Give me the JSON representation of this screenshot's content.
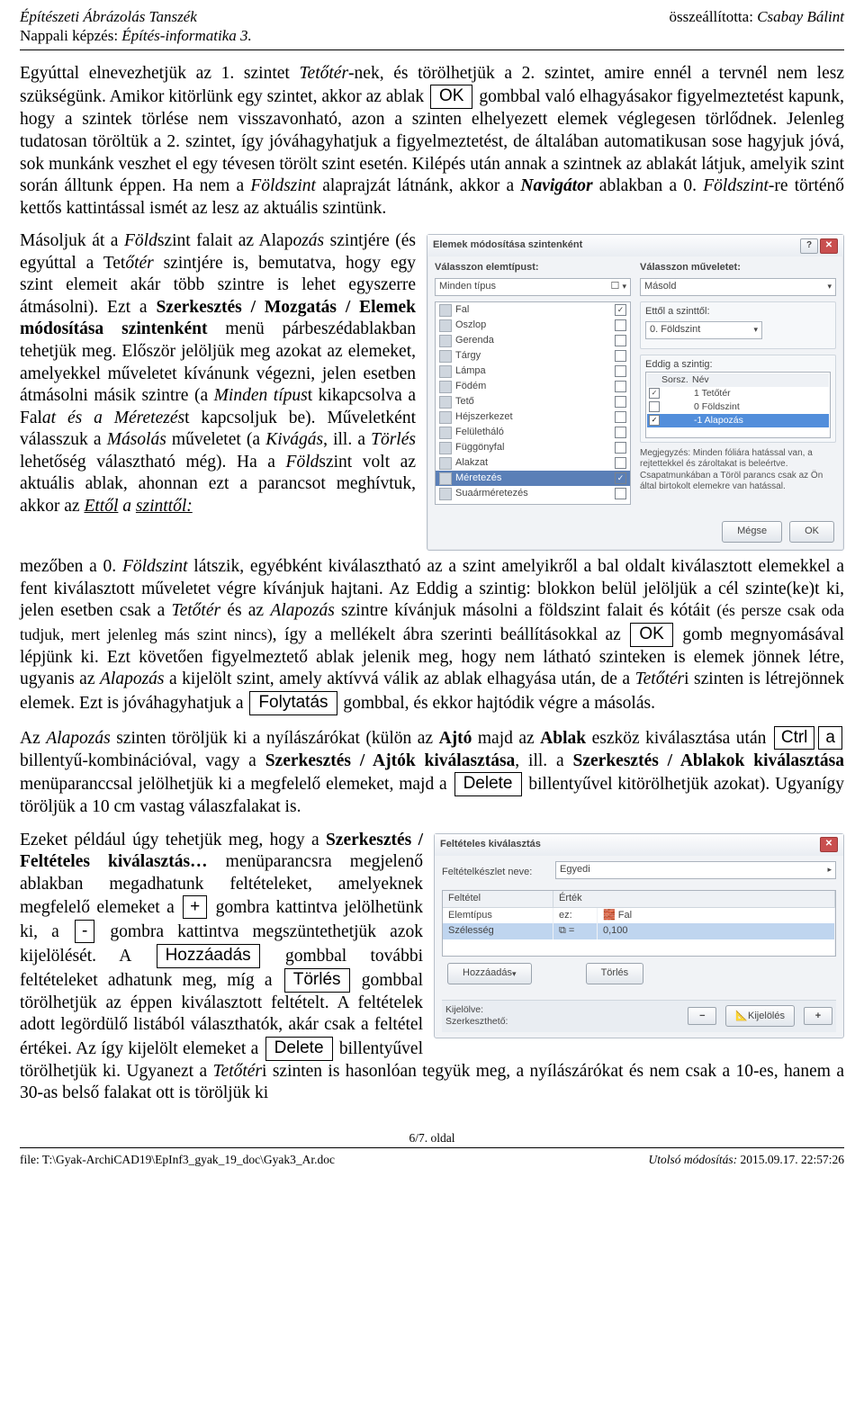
{
  "header": {
    "left_line1_ital": "Építészeti Ábrázolás Tanszék",
    "left_line2_prefix": "Nappali képzés:   ",
    "left_line2_ital": "Építés-informatika 3.",
    "right_prefix": "összeállította: ",
    "right_ital": "Csabay Bálint"
  },
  "keys": {
    "ok": "OK",
    "folytatas": "Folytatás",
    "ctrl": "Ctrl",
    "a": "a",
    "delete": "Delete",
    "plus": "+",
    "minus": "-",
    "hozzaadas": "Hozzáadás",
    "torles": "Törlés"
  },
  "p1": {
    "a": "Egyúttal elnevezhetjük az 1. szintet ",
    "b": "Tetőtér",
    "c": "-nek, és törölhetjük a 2. szintet, amire ennél a tervnél nem lesz szükségünk. Amikor kitörlünk egy szintet, akkor az ablak ",
    "d": " gombbal való elhagyásakor figyelmeztetést kapunk, hogy a szintek törlése nem visszavonható, azon a szinten elhelyezett elemek véglegesen törlődnek. Jelenleg tudatosan töröltük a 2. szintet, így jóváhagyhatjuk a figyelmeztetést, de általában automatikusan sose hagyjuk jóvá, sok munkánk veszhet el egy tévesen törölt szint esetén. Kilépés után annak a szintnek az ablakát látjuk, amelyik szint során álltunk éppen. Ha nem a ",
    "e": "Földszint",
    "f": " alaprajzát látnánk, akkor a ",
    "g": "Navigátor",
    "h": " ablakban a 0. ",
    "i": "Földszint",
    "j": "-re történő kettős kattintással ismét az lesz az aktuális szintünk."
  },
  "p2": {
    "a": "Másoljuk át a ",
    "b": "Föld",
    "c": "szint falait az Alap",
    "d": "ozás",
    "e": " szintjére (és egyúttal a Tet",
    "f": "őtér",
    "g": " szintjére is, bemutatva, hogy egy szint elemeit akár több szintre is lehet egyszerre átmásolni). Ezt a ",
    "h": "Szerkesztés / Mozgatás / Elemek módosítása szintenként",
    "i": " menü párbeszédablakban tehetjük meg. Először jelöljük meg azokat az elemeket, amelyekkel műveletet kívánunk végezni, jelen esetben átmásolni másik szintre (a ",
    "j": "Minden típus",
    "k": "t kikapcsolva a Fal",
    "l": "at és a ",
    "m": "Méretezés",
    "n": "t kapcsoljuk be). Műveletként válasszuk a ",
    "o": "Másolás",
    "p": " műveletet (a ",
    "q": "Kivágás",
    "r": ", ill. a ",
    "s": "Törlés",
    "t": " lehetőség választható még). Ha a ",
    "u": "Föld",
    "v": "szint volt az aktuális ablak, ahonnan ezt a parancsot meghívtuk, akkor az ",
    "w": "Ettől",
    "x": " a ",
    "y": "szinttől:"
  },
  "p3": {
    "a": "mezőben a 0. ",
    "b": "Földszint",
    "c": " látszik, egyébként kiválasztható az a szint amelyikről a bal oldalt kiválasztott elemekkel a fent kiválasztott műveletet végre kívánjuk hajtani. Az Eddig a szintig: blokkon belül jelöljük a cél szinte(ke)t ki, jelen esetben csak a ",
    "d": "Tetőtér",
    "e": " és az ",
    "f": "Alapozás",
    "g": " szintre kívánjuk másolni a földszint falait és kótáit ",
    "h": "(és persze csak oda tudjuk, mert jelenleg más szint nincs)",
    "i": ", így a mellékelt ábra szerinti beállításokkal az ",
    "j": " gomb megnyomásával lépjünk ki. Ezt követően figyelmeztető ablak jelenik meg, hogy nem látható szinteken is elemek jönnek létre, ugyanis az ",
    "k": "Alapozás",
    "l": " a kijelölt szint, amely aktívvá válik az ablak elhagyása után, de a ",
    "m": "Tetőtér",
    "n": "i szinten is létrejönnek elemek. Ezt is jóváhagyhatjuk a ",
    "o": " gombbal, és ekkor hajtódik végre a másolás."
  },
  "p4": {
    "a": "Az ",
    "b": "Alapozás",
    "c": " szinten töröljük ki a nyílászárókat (külön az ",
    "d": "Ajtó",
    "e": " majd az ",
    "f": "Ablak",
    "g": " eszköz kiválasztása után ",
    "h": " billentyű-kombinációval, vagy a ",
    "i": "Szerkesztés / Ajtók kiválasztása",
    "j": ", ill. a ",
    "k": "Szerkesztés / Ablakok kiválasztása",
    "l": " menüparanccsal jelölhetjük ki a megfelelő elemeket, majd a ",
    "m": " billentyűvel kitörölhetjük azokat). Ugyanígy töröljük a 10 cm vastag válaszfalakat is."
  },
  "p5": {
    "a": "Ezeket például úgy tehetjük meg, hogy a ",
    "b": "Szerkesztés / Feltételes kiválasztás…",
    "c": " menüparancsra megjelenő ablakban megadhatunk feltételeket, amelyeknek megfelelő elemeket a ",
    "d": " gombra kattintva jelölhetünk ki, a ",
    "e": " gombra kattintva megszüntethetjük azok kijelölését. A ",
    "f": " gombbal további feltételeket adhatunk meg, míg a ",
    "g": " gombbal törölhetjük az éppen kiválasztott feltételt. A feltételek adott legördülő listából választhatók, akár csak a feltétel értékei. Az így kijelölt elemeket a ",
    "h": " billentyűvel törölhetjük ki. Ugyanezt a ",
    "i": "Tetőtér",
    "j": "i szinten is hasonlóan tegyük meg, a nyílászárókat és nem csak a 10-es, hanem a 30-as belső falakat ott is töröljük ki"
  },
  "dialog1": {
    "title": "Elemek módosítása szintenként",
    "left_label": "Válasszon elemtípust:",
    "right_label": "Válasszon műveletet:",
    "combo_left": "Minden típus",
    "combo_right": "Másold",
    "items": [
      "Fal",
      "Oszlop",
      "Gerenda",
      "Tárgy",
      "Lámpa",
      "Födém",
      "Tető",
      "Héjszerkezet",
      "Felületháló",
      "Függönyfal",
      "Alakzat",
      "Méretezés",
      "Suaárméretezés"
    ],
    "checked": [
      true,
      false,
      false,
      false,
      false,
      false,
      false,
      false,
      false,
      false,
      false,
      true,
      false
    ],
    "sel_index": 11,
    "from_label": "Ettől a szinttől:",
    "from_value": "0. Földszint",
    "to_label": "Eddig a szintig:",
    "lv_head_a": "Sorsz.",
    "lv_head_b": "Név",
    "levels": [
      {
        "chk": true,
        "a": "",
        "b": "1 Tetőtér"
      },
      {
        "chk": false,
        "a": "",
        "b": "0 Földszint"
      },
      {
        "chk": true,
        "a": "",
        "b": "-1 Alapozás",
        "sel": true
      }
    ],
    "note": "Megjegyzés: Minden fóliára hatással van, a rejtettekkel és zároltakat is beleértve. Csapatmunkában a Töröl parancs csak az Ön által birtokolt elemekre van hatással.",
    "btn_cancel": "Mégse",
    "btn_ok": "OK"
  },
  "dialog2": {
    "title": "Feltételes kiválasztás",
    "set_label": "Feltételkészlet neve:",
    "set_value": "Egyedi",
    "col_a": "Feltétel",
    "col_b": "Érték",
    "row1": {
      "a": "Elemtípus",
      "op": "ez:",
      "val": "Fal"
    },
    "row2": {
      "a": "Szélesség",
      "op": "=",
      "val": "0,100"
    },
    "btn_add": "Hozzáadás",
    "btn_del": "Törlés",
    "sel_lab": "Kijelölve:",
    "filter_lab": "Szerkeszthető:",
    "kijel": "Kijelölés"
  },
  "footer": {
    "page": "6/7. oldal",
    "left": "file: T:\\Gyak-ArchiCAD19\\EpInf3_gyak_19_doc\\Gyak3_Ar.doc",
    "right_a": "Utolsó módosítás: ",
    "right_b": "2015.09.17.  22:57:26"
  }
}
